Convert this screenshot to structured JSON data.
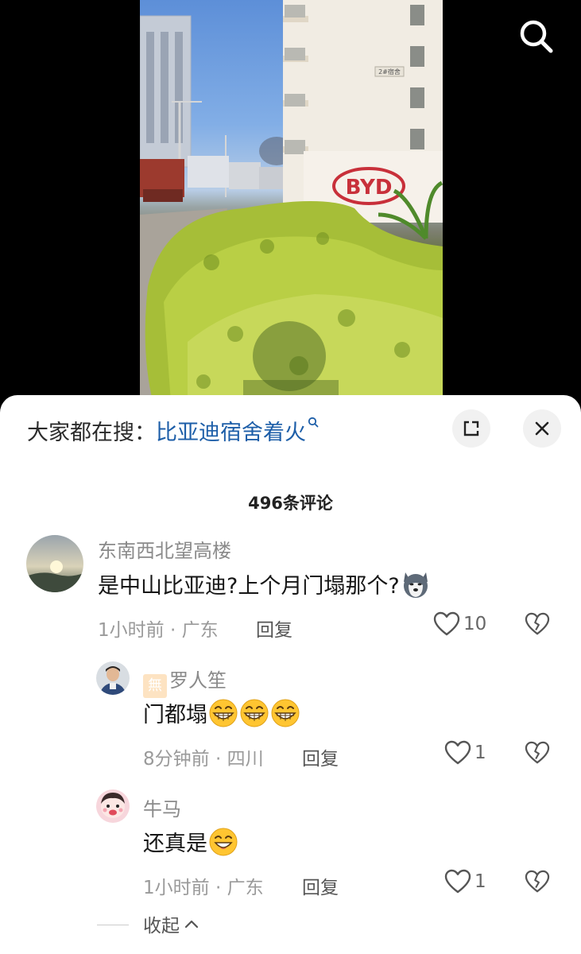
{
  "hot_search": {
    "prefix": "大家都在搜：",
    "term": "比亚迪宿舍着火"
  },
  "video": {
    "sign_text": "BYD",
    "building_label": "2#宿舍"
  },
  "comments_header": {
    "count_label": "496条评论"
  },
  "comments": [
    {
      "username": "东南西北望高楼",
      "text": "是中山比亚迪?上个月门塌那个?",
      "time": "1小时前",
      "location": "广东",
      "reply_label": "回复",
      "likes": "10"
    },
    {
      "username": "罗人笙",
      "badge": "無",
      "text": "门都塌",
      "time": "8分钟前",
      "location": "四川",
      "reply_label": "回复",
      "likes": "1"
    },
    {
      "username": "牛马",
      "text": "还真是",
      "time": "1小时前",
      "location": "广东",
      "reply_label": "回复",
      "likes": "1"
    }
  ],
  "collapse_label": "收起",
  "icons": {
    "search": "search-icon",
    "expand": "expand-icon",
    "close": "close-icon",
    "like": "heart-icon",
    "dislike": "broken-heart-icon"
  },
  "colors": {
    "hot_term": "#1d5ea8",
    "meta_text": "#9a9a9a",
    "sheet_bg": "#ffffff"
  }
}
